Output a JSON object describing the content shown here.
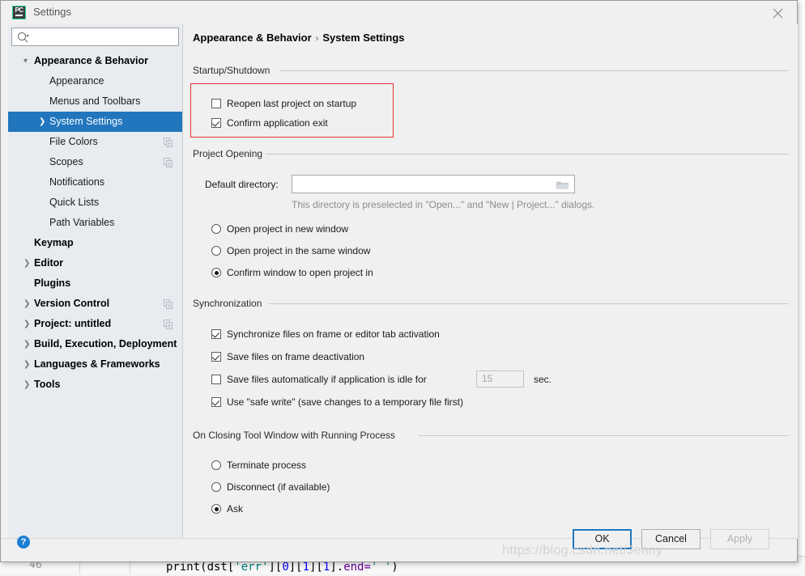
{
  "window": {
    "title": "Settings",
    "app_icon": "pycharm-icon",
    "app_icon_text": "PC",
    "close_icon": "close-icon"
  },
  "search": {
    "placeholder": "",
    "value": "",
    "icon": "search-icon"
  },
  "sidebar": {
    "items": [
      {
        "label": "Appearance & Behavior",
        "level": 0,
        "arrow": "expanded",
        "selected": false,
        "copy_icon": false
      },
      {
        "label": "Appearance",
        "level": 1,
        "arrow": "none",
        "selected": false,
        "copy_icon": false
      },
      {
        "label": "Menus and Toolbars",
        "level": 1,
        "arrow": "none",
        "selected": false,
        "copy_icon": false
      },
      {
        "label": "System Settings",
        "level": 1,
        "arrow": "collapsed",
        "selected": true,
        "copy_icon": false
      },
      {
        "label": "File Colors",
        "level": 1,
        "arrow": "none",
        "selected": false,
        "copy_icon": true
      },
      {
        "label": "Scopes",
        "level": 1,
        "arrow": "none",
        "selected": false,
        "copy_icon": true
      },
      {
        "label": "Notifications",
        "level": 1,
        "arrow": "none",
        "selected": false,
        "copy_icon": false
      },
      {
        "label": "Quick Lists",
        "level": 1,
        "arrow": "none",
        "selected": false,
        "copy_icon": false
      },
      {
        "label": "Path Variables",
        "level": 1,
        "arrow": "none",
        "selected": false,
        "copy_icon": false
      },
      {
        "label": "Keymap",
        "level": 0,
        "arrow": "none",
        "selected": false,
        "copy_icon": false
      },
      {
        "label": "Editor",
        "level": 0,
        "arrow": "collapsed",
        "selected": false,
        "copy_icon": false
      },
      {
        "label": "Plugins",
        "level": 0,
        "arrow": "none",
        "selected": false,
        "copy_icon": false
      },
      {
        "label": "Version Control",
        "level": 0,
        "arrow": "collapsed",
        "selected": false,
        "copy_icon": true
      },
      {
        "label": "Project: untitled",
        "level": 0,
        "arrow": "collapsed",
        "selected": false,
        "copy_icon": true
      },
      {
        "label": "Build, Execution, Deployment",
        "level": 0,
        "arrow": "collapsed",
        "selected": false,
        "copy_icon": false
      },
      {
        "label": "Languages & Frameworks",
        "level": 0,
        "arrow": "collapsed",
        "selected": false,
        "copy_icon": false
      },
      {
        "label": "Tools",
        "level": 0,
        "arrow": "collapsed",
        "selected": false,
        "copy_icon": false
      }
    ]
  },
  "breadcrumb": {
    "root": "Appearance & Behavior",
    "separator": "›",
    "current": "System Settings"
  },
  "sections": {
    "startup": {
      "title": "Startup/Shutdown",
      "options": [
        {
          "label": "Reopen last project on startup",
          "checked": false
        },
        {
          "label": "Confirm application exit",
          "checked": true
        }
      ]
    },
    "project_opening": {
      "title": "Project Opening",
      "directory_label": "Default directory:",
      "directory_value": "",
      "directory_placeholder": "",
      "directory_icon": "folder-icon",
      "hint": "This directory is preselected in \"Open...\" and \"New | Project...\" dialogs.",
      "radios": [
        {
          "label": "Open project in new window",
          "checked": false
        },
        {
          "label": "Open project in the same window",
          "checked": false
        },
        {
          "label": "Confirm window to open project in",
          "checked": true
        }
      ]
    },
    "synchronization": {
      "title": "Synchronization",
      "options": [
        {
          "label": "Synchronize files on frame or editor tab activation",
          "checked": true
        },
        {
          "label": "Save files on frame deactivation",
          "checked": true
        },
        {
          "label": "Save files automatically if application is idle for",
          "checked": false
        },
        {
          "label": "Use \"safe write\" (save changes to a temporary file first)",
          "checked": true
        }
      ],
      "idle_value": "15",
      "idle_unit": "sec."
    },
    "closing_tool_window": {
      "title": "On Closing Tool Window with Running Process",
      "radios": [
        {
          "label": "Terminate process",
          "checked": false
        },
        {
          "label": "Disconnect (if available)",
          "checked": false
        },
        {
          "label": "Ask",
          "checked": true
        }
      ]
    }
  },
  "footer": {
    "help_icon": "help-icon",
    "help_label": "?",
    "ok_label": "OK",
    "cancel_label": "Cancel",
    "apply_label": "Apply"
  },
  "background": {
    "line_number": "46",
    "code_prefix": "print(dst[",
    "code_str1": "'err'",
    "code_mid1": "][",
    "code_num1": "0",
    "code_mid2": "][",
    "code_num2": "1",
    "code_mid3": "][",
    "code_num3": "1",
    "code_mid4": "].",
    "code_kw": "end=",
    "code_str2": "' '",
    "code_suffix": ")"
  },
  "watermark": {
    "text": "https://blog.csdn.net/Jenny"
  },
  "colors": {
    "selection_blue": "#2176bd",
    "highlight_red": "#e8312f",
    "sidebar_bg": "#e8ecf0",
    "dialog_bg": "#f0f0f0",
    "help_blue": "#1a7fd4"
  }
}
